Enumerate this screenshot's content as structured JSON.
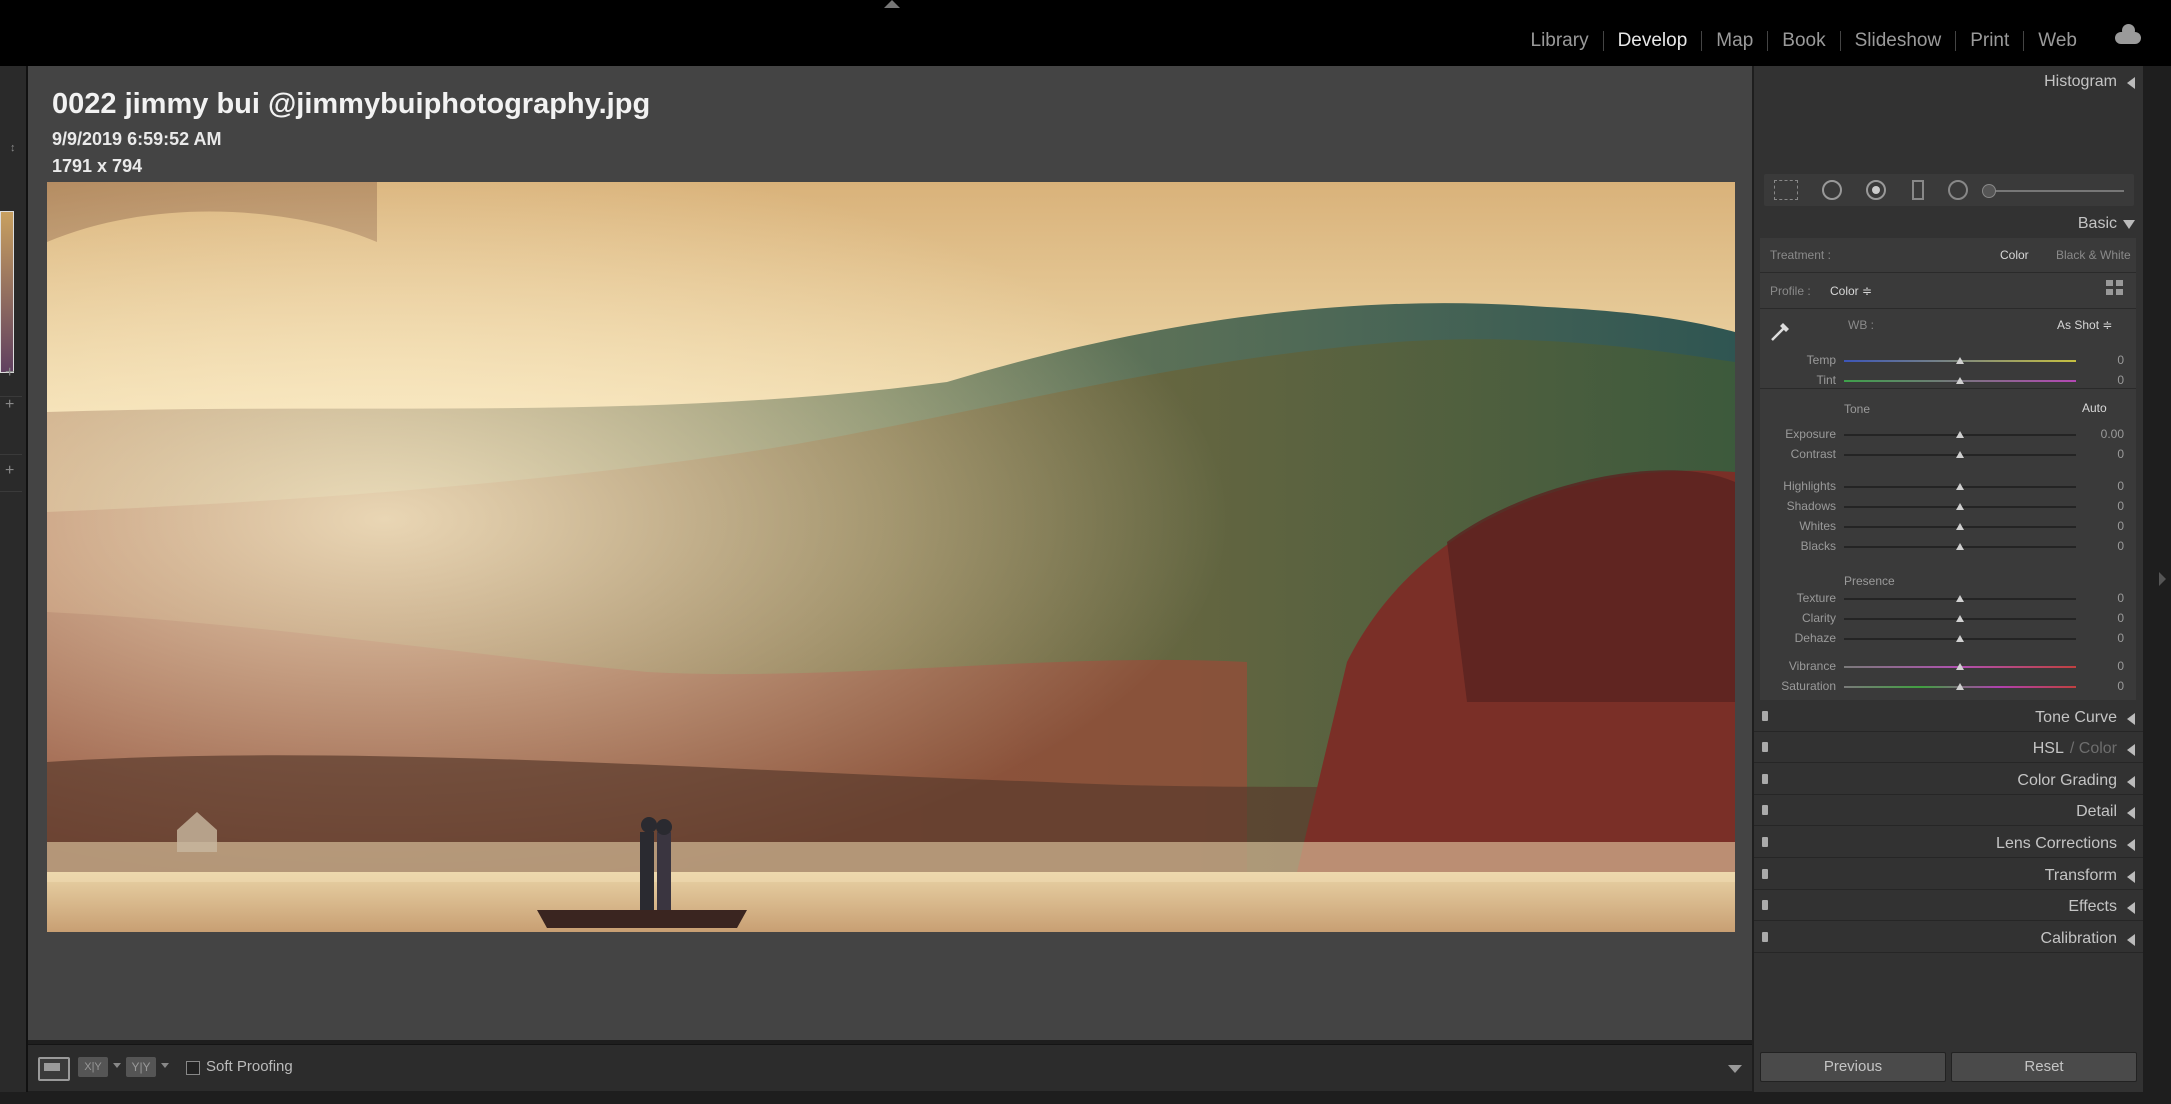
{
  "modules": [
    "Library",
    "Develop",
    "Map",
    "Book",
    "Slideshow",
    "Print",
    "Web"
  ],
  "active_module": "Develop",
  "photo_info": {
    "title": "0022  jimmy bui @jimmybuiphotography.jpg",
    "date": "9/9/2019 6:59:52 AM",
    "dimensions": "1791 x 794"
  },
  "toolbar": {
    "compare_label": "X|Y",
    "survey_label": "Y|Y",
    "soft_proofing_label": "Soft Proofing"
  },
  "panels": {
    "histogram": "Histogram",
    "basic": "Basic",
    "collapsed": [
      "Tone Curve",
      "HSL",
      "Color Grading",
      "Detail",
      "Lens Corrections",
      "Transform",
      "Effects",
      "Calibration"
    ],
    "hsl_color_suffix": "/ Color"
  },
  "basic": {
    "treatment_label": "Treatment :",
    "treatment_color": "Color",
    "treatment_bw": "Black & White",
    "profile_label": "Profile :",
    "profile_value": "Color ≑",
    "wb_label": "WB :",
    "wb_value": "As Shot ≑",
    "tone_label": "Tone",
    "auto_label": "Auto",
    "presence_label": "Presence",
    "sliders": [
      {
        "label": "Temp",
        "value": "0",
        "position": 0.5
      },
      {
        "label": "Tint",
        "value": "0",
        "position": 0.5
      },
      {
        "label": "Exposure",
        "value": "0.00",
        "position": 0.5
      },
      {
        "label": "Contrast",
        "value": "0",
        "position": 0.5
      },
      {
        "label": "Highlights",
        "value": "0",
        "position": 0.5
      },
      {
        "label": "Shadows",
        "value": "0",
        "position": 0.5
      },
      {
        "label": "Whites",
        "value": "0",
        "position": 0.5
      },
      {
        "label": "Blacks",
        "value": "0",
        "position": 0.5
      },
      {
        "label": "Texture",
        "value": "0",
        "position": 0.5
      },
      {
        "label": "Clarity",
        "value": "0",
        "position": 0.5
      },
      {
        "label": "Dehaze",
        "value": "0",
        "position": 0.5
      },
      {
        "label": "Vibrance",
        "value": "0",
        "position": 0.5
      },
      {
        "label": "Saturation",
        "value": "0",
        "position": 0.5
      }
    ]
  },
  "buttons": {
    "previous": "Previous",
    "reset": "Reset"
  },
  "colors": {
    "accent_text": "#e8e8e8",
    "panel_bg": "#323232"
  }
}
